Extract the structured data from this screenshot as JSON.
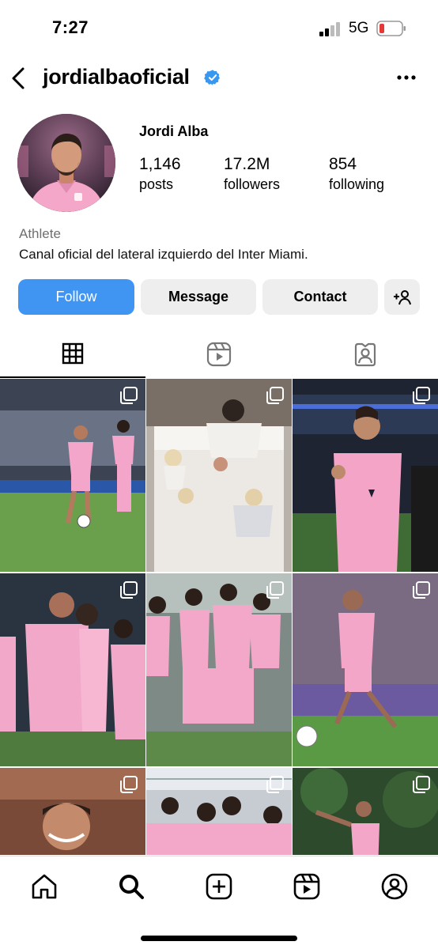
{
  "status_bar": {
    "time": "7:27",
    "network": "5G",
    "battery_color": "#e53935"
  },
  "header": {
    "username": "jordialbaoficial",
    "back_icon": "chevron-left-icon",
    "verified_icon": "verified-badge-icon",
    "more_icon": "more-horizontal-icon",
    "verified_color": "#3897f0"
  },
  "profile": {
    "full_name": "Jordi Alba",
    "stats": {
      "posts": {
        "value": "1,146",
        "label": "posts"
      },
      "followers": {
        "value": "17.2M",
        "label": "followers"
      },
      "following": {
        "value": "854",
        "label": "following"
      }
    },
    "category": "Athlete",
    "bio": "Canal oficial del lateral izquierdo del Inter Miami."
  },
  "actions": {
    "follow": "Follow",
    "message": "Message",
    "contact": "Contact",
    "add_user_icon": "add-person-icon",
    "follow_color": "#4095f3"
  },
  "tabs": [
    {
      "name": "posts",
      "icon": "grid-icon",
      "active": true
    },
    {
      "name": "reels",
      "icon": "reels-icon",
      "active": false
    },
    {
      "name": "tagged",
      "icon": "tagged-person-icon",
      "active": false
    }
  ],
  "grid": {
    "posts": [
      {
        "scene": "player-dribbling-on-pitch",
        "multi": true
      },
      {
        "scene": "family-on-bed",
        "multi": true
      },
      {
        "scene": "player-celebrating-fist",
        "multi": true
      },
      {
        "scene": "team-hug-suarez",
        "multi": true
      },
      {
        "scene": "team-group-celebration",
        "multi": true
      },
      {
        "scene": "player-running-with-ball",
        "multi": true
      },
      {
        "scene": "player-smiling-closeup",
        "multi": true
      },
      {
        "scene": "team-celebrating-goal",
        "multi": true
      },
      {
        "scene": "player-waving-trees",
        "multi": true
      }
    ]
  },
  "bottom_nav": [
    {
      "icon": "home-icon"
    },
    {
      "icon": "search-icon"
    },
    {
      "icon": "create-post-icon"
    },
    {
      "icon": "reels-icon"
    },
    {
      "icon": "profile-icon"
    }
  ]
}
